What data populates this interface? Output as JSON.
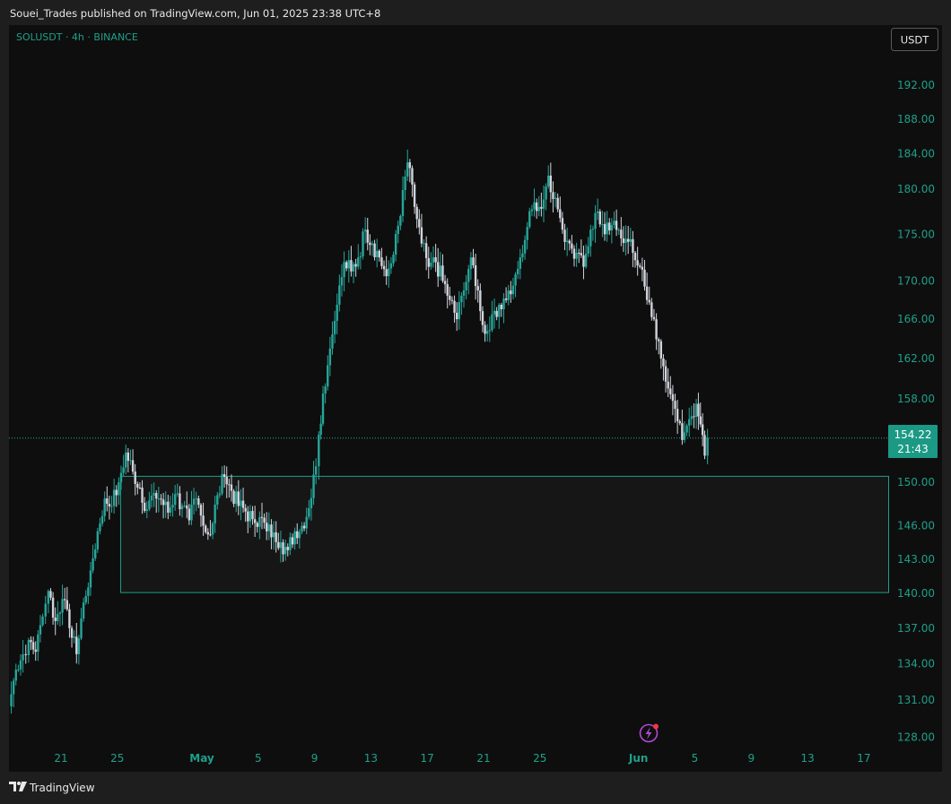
{
  "header": {
    "publisher_text": "Souei_Trades published on TradingView.com, Jun 01, 2025 23:38 UTC+8"
  },
  "chart": {
    "symbol_label": "SOLUSDT · 4h · BINANCE",
    "currency_button": "USDT",
    "price_badge": {
      "price": "154.22",
      "countdown": "21:43"
    },
    "colors": {
      "background": "#0e0e0e",
      "bull_candle": "#26a69a",
      "bear_candle": "#d1d4dc",
      "axis_text": "#1fa08a",
      "zone_border": "#1f9f8a",
      "zone_fill": "#161616",
      "price_line": "#26a69a",
      "badge_bg": "#1b9985"
    },
    "icons": {
      "lightning": "lightning-icon",
      "logo": "tradingview-logo-icon"
    }
  },
  "chart_data": {
    "type": "candlestick",
    "symbol": "SOLUSDT",
    "interval": "4h",
    "exchange": "BINANCE",
    "y_scale": "log",
    "ylim": [
      125.3,
      199.3
    ],
    "y_ticks": [
      "192.00",
      "188.00",
      "184.00",
      "180.00",
      "175.00",
      "170.00",
      "166.00",
      "162.00",
      "158.00",
      "150.00",
      "146.00",
      "143.00",
      "140.00",
      "137.00",
      "134.00",
      "131.00",
      "128.00"
    ],
    "x_ticks": [
      {
        "label": "21",
        "bold": false,
        "day": 0
      },
      {
        "label": "25",
        "bold": false,
        "day": 4
      },
      {
        "label": "May",
        "bold": true,
        "day": 10
      },
      {
        "label": "5",
        "bold": false,
        "day": 14
      },
      {
        "label": "9",
        "bold": false,
        "day": 18
      },
      {
        "label": "13",
        "bold": false,
        "day": 22
      },
      {
        "label": "17",
        "bold": false,
        "day": 26
      },
      {
        "label": "21",
        "bold": false,
        "day": 30
      },
      {
        "label": "25",
        "bold": false,
        "day": 34
      },
      {
        "label": "Jun",
        "bold": true,
        "day": 41
      },
      {
        "label": "5",
        "bold": false,
        "day": 45
      },
      {
        "label": "9",
        "bold": false,
        "day": 49
      },
      {
        "label": "13",
        "bold": false,
        "day": 53
      },
      {
        "label": "17",
        "bold": false,
        "day": 57
      }
    ],
    "last_price": 154.22,
    "support_zone": {
      "top": 150.6,
      "bottom": 140.1,
      "start_day": 4.2
    },
    "anchors": [
      [
        -3.7,
        130.5
      ],
      [
        -3.2,
        133.5
      ],
      [
        -2.7,
        134.8
      ],
      [
        -2.3,
        136.0
      ],
      [
        -1.8,
        135.0
      ],
      [
        -1.3,
        138.0
      ],
      [
        -0.9,
        140.2
      ],
      [
        -0.4,
        137.6
      ],
      [
        0.1,
        139.5
      ],
      [
        0.6,
        137.0
      ],
      [
        1.1,
        134.8
      ],
      [
        1.6,
        139.2
      ],
      [
        2.1,
        142.0
      ],
      [
        2.6,
        145.5
      ],
      [
        3.1,
        148.5
      ],
      [
        3.6,
        147.8
      ],
      [
        4.1,
        150.0
      ],
      [
        4.6,
        152.8
      ],
      [
        5.1,
        151.0
      ],
      [
        5.6,
        149.5
      ],
      [
        6.1,
        147.5
      ],
      [
        6.6,
        149.0
      ],
      [
        7.1,
        148.4
      ],
      [
        7.6,
        147.2
      ],
      [
        8.1,
        148.9
      ],
      [
        8.6,
        147.8
      ],
      [
        9.1,
        146.5
      ],
      [
        9.6,
        148.5
      ],
      [
        10.1,
        146.0
      ],
      [
        10.6,
        145.2
      ],
      [
        11.1,
        148.8
      ],
      [
        11.6,
        150.5
      ],
      [
        12.1,
        149.2
      ],
      [
        12.6,
        147.8
      ],
      [
        13.1,
        147.3
      ],
      [
        13.6,
        146.6
      ],
      [
        14.1,
        146.8
      ],
      [
        14.6,
        145.5
      ],
      [
        15.1,
        145.4
      ],
      [
        15.6,
        144.5
      ],
      [
        16.1,
        143.8
      ],
      [
        16.6,
        145.5
      ],
      [
        17.1,
        146.0
      ],
      [
        17.6,
        147.6
      ],
      [
        18.1,
        151.5
      ],
      [
        18.3,
        154.5
      ],
      [
        18.6,
        158.5
      ],
      [
        19.1,
        163.0
      ],
      [
        19.6,
        167.5
      ],
      [
        20.1,
        172.0
      ],
      [
        20.6,
        171.0
      ],
      [
        21.1,
        172.5
      ],
      [
        21.6,
        175.5
      ],
      [
        22.1,
        174.0
      ],
      [
        22.6,
        172.5
      ],
      [
        23.1,
        170.5
      ],
      [
        23.6,
        172.8
      ],
      [
        24.1,
        177.0
      ],
      [
        24.6,
        183.0
      ],
      [
        25.1,
        178.0
      ],
      [
        25.6,
        174.0
      ],
      [
        26.1,
        171.5
      ],
      [
        26.6,
        172.0
      ],
      [
        27.1,
        170.0
      ],
      [
        27.6,
        168.0
      ],
      [
        28.1,
        166.0
      ],
      [
        28.6,
        169.0
      ],
      [
        29.1,
        172.5
      ],
      [
        29.6,
        169.0
      ],
      [
        30.1,
        164.5
      ],
      [
        30.6,
        166.5
      ],
      [
        31.1,
        167.5
      ],
      [
        31.6,
        168.0
      ],
      [
        32.1,
        169.5
      ],
      [
        32.6,
        172.5
      ],
      [
        33.1,
        175.8
      ],
      [
        33.6,
        178.5
      ],
      [
        34.1,
        177.8
      ],
      [
        34.6,
        181.5
      ],
      [
        35.1,
        179.0
      ],
      [
        35.6,
        175.5
      ],
      [
        36.1,
        174.0
      ],
      [
        36.6,
        173.0
      ],
      [
        37.1,
        171.5
      ],
      [
        37.6,
        175.5
      ],
      [
        38.1,
        177.5
      ],
      [
        38.6,
        175.0
      ],
      [
        39.1,
        176.0
      ],
      [
        39.6,
        175.5
      ],
      [
        40.1,
        174.5
      ],
      [
        40.6,
        173.0
      ],
      [
        41.1,
        171.5
      ],
      [
        41.6,
        168.0
      ],
      [
        42.1,
        166.0
      ],
      [
        42.6,
        162.0
      ],
      [
        43.1,
        159.0
      ],
      [
        43.6,
        157.0
      ],
      [
        44.1,
        154.0
      ],
      [
        44.6,
        156.0
      ],
      [
        45.1,
        157.5
      ],
      [
        45.4,
        155.5
      ],
      [
        45.7,
        152.5
      ],
      [
        45.9,
        154.2
      ]
    ]
  }
}
